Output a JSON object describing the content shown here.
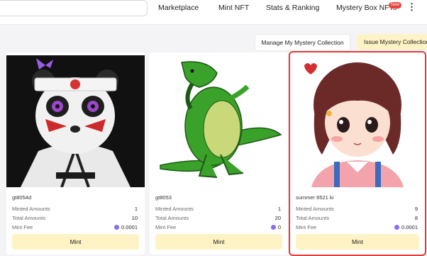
{
  "nav": {
    "items": [
      "Marketplace",
      "Mint NFT",
      "Stats & Ranking",
      "Mystery Box NFTs"
    ],
    "new_badge": "New",
    "more": "⋮"
  },
  "actions": {
    "manage": "Manage My Mystery Collection",
    "issue": "Issue Mystery Collection"
  },
  "labels": {
    "minted": "Minted Amounts",
    "total": "Total Amounts",
    "fee": "Mint Fee",
    "mint": "Mint"
  },
  "cards": [
    {
      "name": "gt8054d",
      "minted": "1",
      "total": "10",
      "fee": "0.0001",
      "image": "panda-kimono-icon"
    },
    {
      "name": "gt8053",
      "minted": "1",
      "total": "20",
      "fee": "0",
      "image": "green-dinosaur-icon"
    },
    {
      "name": "summer 8521 ki",
      "minted": "9",
      "total": "8",
      "fee": "0.0001",
      "image": "girl-portrait-icon",
      "selected": true
    }
  ],
  "colors": {
    "accent": "#fdf3c4",
    "selection": "#e23b3b",
    "badge": "#e8443a",
    "coin": "#8a6cf0"
  }
}
